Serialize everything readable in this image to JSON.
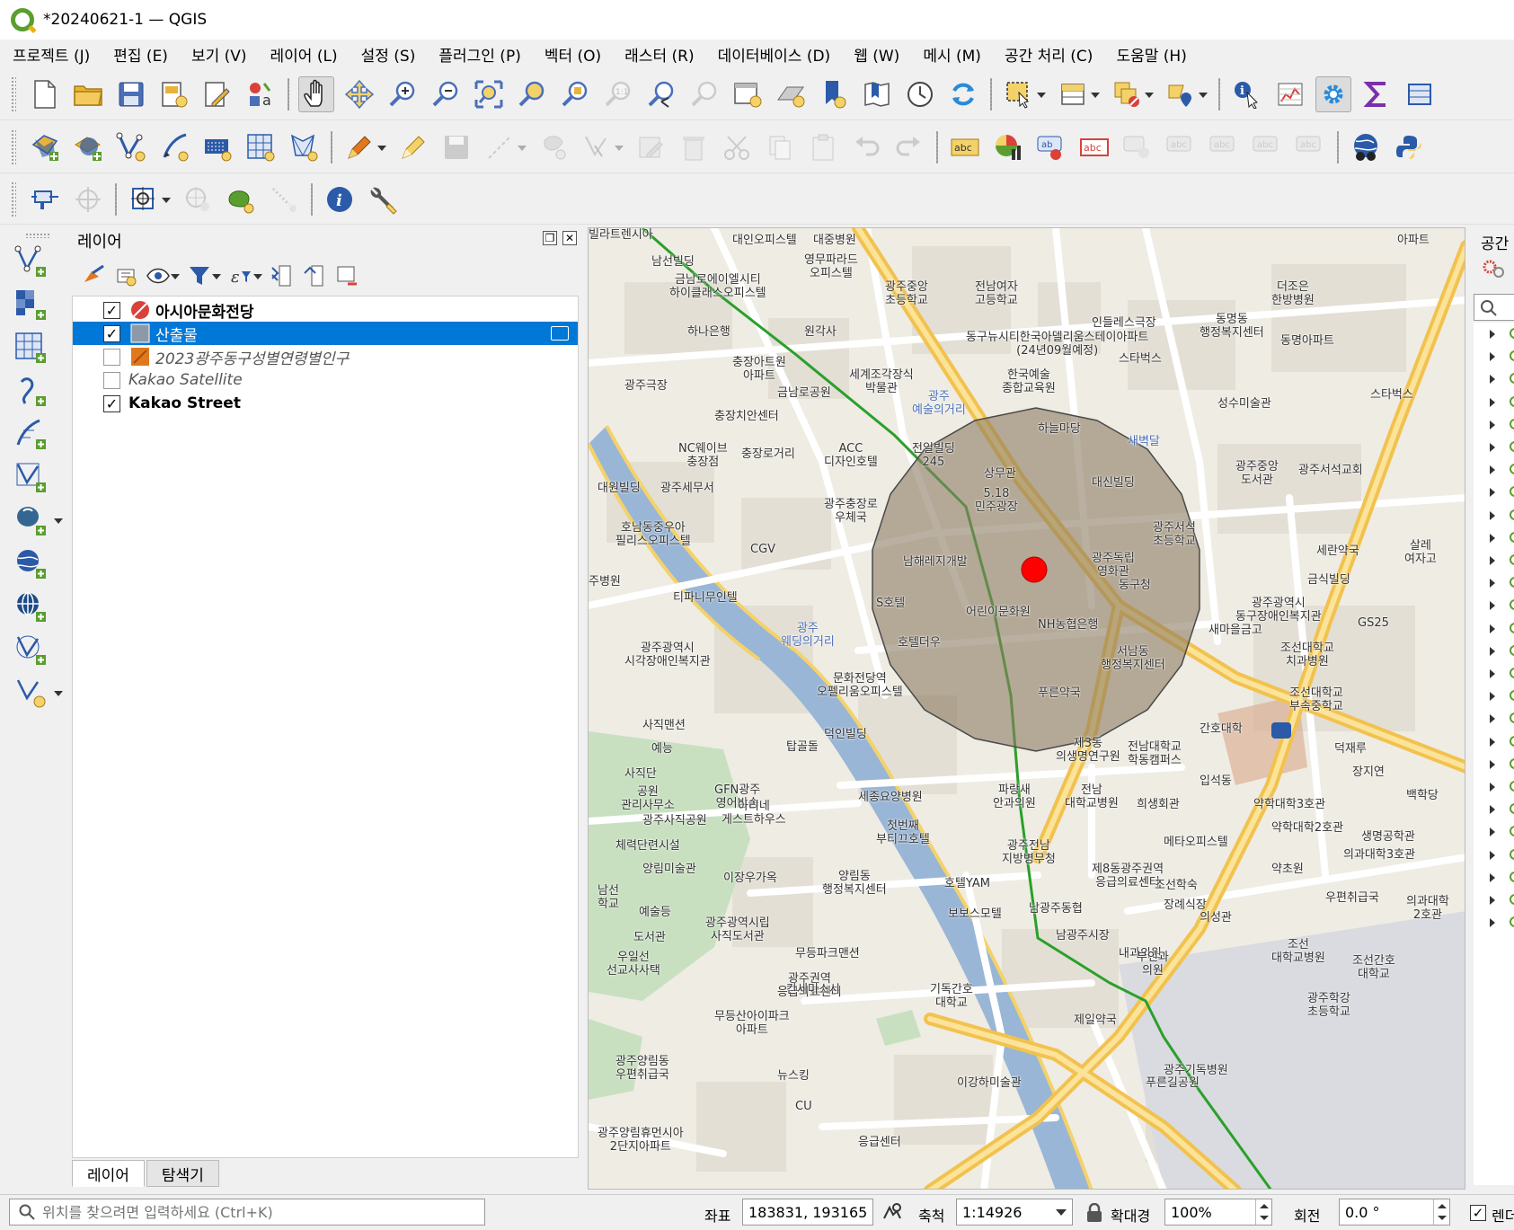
{
  "window": {
    "title": "*20240621-1 — QGIS"
  },
  "menubar": {
    "items": [
      "프로젝트 (J)",
      "편집 (E)",
      "보기 (V)",
      "레이어 (L)",
      "설정 (S)",
      "플러그인 (P)",
      "벡터 (O)",
      "래스터 (R)",
      "데이터베이스 (D)",
      "웹 (W)",
      "메시 (M)",
      "공간 처리 (C)",
      "도움말 (H)"
    ]
  },
  "layers_panel": {
    "title": "레이어",
    "layers": [
      {
        "name": "아시아문화전당",
        "checked": true,
        "style": "bold"
      },
      {
        "name": "산출물",
        "checked": true,
        "style": "selected"
      },
      {
        "name": "2023광주동구성별연령별인구",
        "checked": false,
        "style": "italic"
      },
      {
        "name": "Kakao Satellite",
        "checked": false,
        "style": "italic"
      },
      {
        "name": "Kakao Street",
        "checked": true,
        "style": "bold"
      }
    ],
    "tabs": [
      "레이어",
      "탐색기"
    ]
  },
  "processing_panel": {
    "title": "공간"
  },
  "map": {
    "buffer_fill": "#8c7b63",
    "point_color": "#ff0000",
    "labels": [
      "대인오피스텔",
      "대중병원",
      "아파트",
      "남선빌딩",
      "영무파라드\n오피스텔",
      "금남로에이엘시티\n하이클래스오피스텔",
      "광주중앙\n초등학교",
      "전남여자\n고등학교",
      "더조은\n한방병원",
      "인들레스극장",
      "동명동\n행정복지센터",
      "동명아파트",
      "하나은행",
      "원각사",
      "동구뉴시티한국아델리움스테이아파트\n(24년09월예정)",
      "충장아트원\n아파트",
      "세계조각장식\n박물관",
      "스타벅스",
      "광주극장",
      "금남로공원",
      "한국예술\n종합교육원",
      "성수미술관",
      "스타벅스",
      "충장치안센터",
      "광주\n예술의거리",
      "하늘마당",
      "새벽달",
      "NC웨이브\n충장점",
      "충장로거리",
      "ACC\n디자인호텔",
      "전일빌딩\n245",
      "광주중앙\n도서관",
      "광주서석교회",
      "대원빌딩",
      "광주세무서",
      "상무관",
      "대신빌딩",
      "광주충장로\n우체국",
      "5.18\n민주광장",
      "호남동중우아\n필리스오피스텔",
      "CGV",
      "광주서석\n초등학교",
      "세란약국",
      "살레\n여자고",
      "남해레지개발",
      "광주독립\n영화관",
      "동구청",
      "금식빌딩",
      "주병원",
      "티파니무인텔",
      "S호텔",
      "어린이문화원",
      "광주\n웨딩의거리",
      "NH농협은행",
      "광주광역시\n동구장애인복지관",
      "GS25",
      "광주광역시\n시각장애인복지관",
      "호텔더우",
      "서남동\n행정복지센터",
      "새마을금고",
      "조선대학교\n치과병원",
      "문화전당역\n오펠리움오피스텔",
      "푸른약국",
      "조선대학교\n부속중학교",
      "사직맨션",
      "덕인빌딩",
      "간호대학",
      "덕재루",
      "탑골돌",
      "제3동\n의생명연구원",
      "전남대학교\n학동캠퍼스",
      "장지연",
      "예능",
      "사직단",
      "공원\n관리사무소",
      "GFN광주\n영어방송",
      "세종요양병원",
      "파랑새\n안과의원",
      "전남\n대학교병원",
      "입석동",
      "백학당",
      "희생회관",
      "약학대학3호관",
      "광주사직공원",
      "아리네\n게스트하우스",
      "첫번째\n부티끄호텔",
      "약학대학2호관",
      "생명공학관",
      "체력단련시설",
      "광주전남\n지방병무청",
      "메타오피스텔",
      "의과대학3호관",
      "양림미술관",
      "제8동광주권역\n응급의료센터",
      "약초원",
      "이장우가옥",
      "양림동\n행정복지센터",
      "호텔YAM",
      "조선학숙",
      "우편취급국",
      "남선\n학교",
      "장례식장",
      "의과대학\n2호관",
      "보보스모텔",
      "남광주동협",
      "예술등",
      "의성관",
      "도서관",
      "광주광역시립\n사직도서관",
      "남광주시장",
      "조선\n대학교병원",
      "무등파크맨션",
      "내과의원",
      "우일선\n선교사사택",
      "부인과\n의원",
      "조선간호\n대학교",
      "광주권역\n응급의료센터",
      "칸세미스시",
      "기독간호\n대학교",
      "광주학강\n초등학교",
      "제일약국",
      "무등산아이파크\n아파트",
      "광주양림동\n우편취급국",
      "광주기독병원",
      "뉴스킹",
      "이강하미술관",
      "푸른길공원",
      "CU",
      "광주양림휴먼시아\n2단지아파트",
      "응급센터",
      "빌라트렌시아"
    ]
  },
  "statusbar": {
    "locator_placeholder": "위치를 찾으려면 입력하세요 (Ctrl+K)",
    "coord_label": "좌표",
    "coord_value": "183831, 193165",
    "scale_label": "축척",
    "scale_value": "1:14926",
    "magnifier_label": "확대경",
    "magnifier_value": "100%",
    "rotation_label": "회전",
    "rotation_value": "0.0 °",
    "render_label": "렌더"
  },
  "icons": {
    "toolbar1": [
      "new-project-icon",
      "open-project-icon",
      "save-project-icon",
      "print-layout-icon",
      "layout-manager-icon",
      "style-manager-icon",
      "pan-icon",
      "pan-to-selection-icon",
      "zoom-in-icon",
      "zoom-out-icon",
      "zoom-full-icon",
      "zoom-to-selection-icon",
      "zoom-to-layer-icon",
      "zoom-native-icon",
      "zoom-last-icon",
      "zoom-next-icon",
      "new-map-view-icon",
      "new-3d-view-icon",
      "new-bookmark-icon",
      "show-bookmarks-icon",
      "temporal-controller-icon",
      "refresh-icon",
      "select-features-icon",
      "attribute-table-icon",
      "deselect-icon",
      "select-location-icon",
      "identify-icon",
      "statistics-icon",
      "settings-icon",
      "sigma-icon",
      "toolbox-icon"
    ],
    "toolbar2": [
      "add-vector-layer-icon",
      "add-wms-layer-icon",
      "digitize-icon",
      "digitize-curve-icon",
      "add-delimited-text-icon",
      "add-raster-icon",
      "add-mesh-icon",
      "edit-pencil-icon",
      "toggle-editing-icon",
      "save-edits-icon",
      "add-feature-icon",
      "move-feature-icon",
      "vertex-tool-icon",
      "modify-attributes-icon",
      "delete-selected-icon",
      "cut-icon",
      "copy-icon",
      "paste-icon",
      "undo-icon",
      "redo-icon",
      "label-tool-icon",
      "diagram-icon",
      "label-pin-icon",
      "label-highlight-icon",
      "show-hide-labels-icon",
      "move-label-icon",
      "rotate-label-icon",
      "change-label-icon",
      "label-properties-icon",
      "plugin-globe-icon",
      "python-icon"
    ],
    "toolbar3": [
      "snapping-icon",
      "snapping-advanced-icon",
      "georeferencer-icon",
      "digitize-trace-icon",
      "shape-tool-icon",
      "measure-icon",
      "info-icon",
      "wrench-icon"
    ]
  }
}
